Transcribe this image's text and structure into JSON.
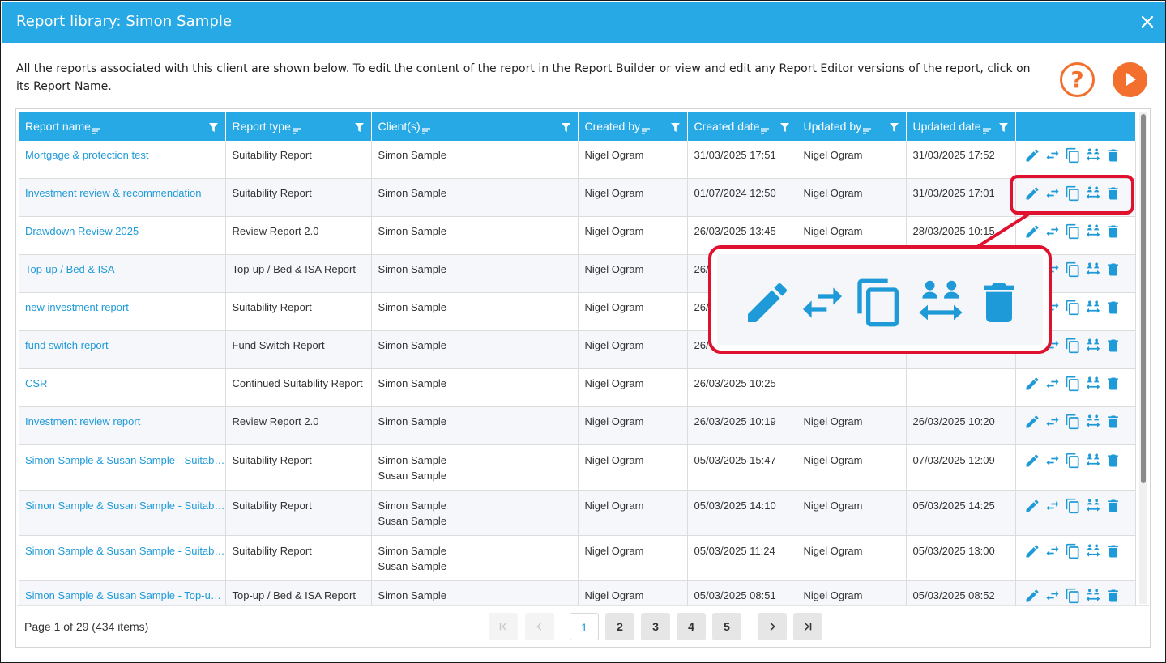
{
  "window": {
    "title": "Report library: Simon Sample",
    "close_icon": "close-icon"
  },
  "intro_text": "All the reports associated with this client are shown below. To edit the content of the report in the Report Builder or view and edit any Report Editor versions of the report, click on its Report Name.",
  "header_buttons": {
    "help_icon": "help-icon",
    "help_symbol": "?",
    "play_icon": "play-icon",
    "accent_color": "#f26f2d"
  },
  "columns": [
    "Report name",
    "Report type",
    "Client(s)",
    "Created by",
    "Created date",
    "Updated by",
    "Updated date",
    ""
  ],
  "rows": [
    {
      "name": "Mortgage & protection test",
      "type": "Suitability Report",
      "client1": "Simon Sample",
      "client2": "",
      "created_by": "Nigel Ogram",
      "created_date": "31/03/2025 17:51",
      "updated_by": "Nigel Ogram",
      "updated_date": "31/03/2025 17:52"
    },
    {
      "name": "Investment review & recommendation",
      "type": "Suitability Report",
      "client1": "Simon Sample",
      "client2": "",
      "created_by": "Nigel Ogram",
      "created_date": "01/07/2024 12:50",
      "updated_by": "Nigel Ogram",
      "updated_date": "31/03/2025 17:01"
    },
    {
      "name": "Drawdown Review 2025",
      "type": "Review Report 2.0",
      "client1": "Simon Sample",
      "client2": "",
      "created_by": "Nigel Ogram",
      "created_date": "26/03/2025 13:45",
      "updated_by": "Nigel Ogram",
      "updated_date": "28/03/2025 10:15"
    },
    {
      "name": "Top-up / Bed & ISA",
      "type": "Top-up / Bed & ISA Report",
      "client1": "Simon Sample",
      "client2": "",
      "created_by": "Nigel Ogram",
      "created_date": "26/",
      "updated_by": "",
      "updated_date": ""
    },
    {
      "name": "new investment report",
      "type": "Suitability Report",
      "client1": "Simon Sample",
      "client2": "",
      "created_by": "Nigel Ogram",
      "created_date": "26/",
      "updated_by": "",
      "updated_date": ""
    },
    {
      "name": "fund switch report",
      "type": "Fund Switch Report",
      "client1": "Simon Sample",
      "client2": "",
      "created_by": "Nigel Ogram",
      "created_date": "26/",
      "updated_by": "",
      "updated_date": ""
    },
    {
      "name": "CSR",
      "type": "Continued Suitability Report",
      "client1": "Simon Sample",
      "client2": "",
      "created_by": "Nigel Ogram",
      "created_date": "26/03/2025 10:25",
      "updated_by": "",
      "updated_date": ""
    },
    {
      "name": "Investment review report",
      "type": "Review Report 2.0",
      "client1": "Simon Sample",
      "client2": "",
      "created_by": "Nigel Ogram",
      "created_date": "26/03/2025 10:19",
      "updated_by": "Nigel Ogram",
      "updated_date": "26/03/2025 10:20"
    },
    {
      "name": "Simon Sample & Susan Sample - Suitabi…",
      "type": "Suitability Report",
      "client1": "Simon Sample",
      "client2": "Susan Sample",
      "created_by": "Nigel Ogram",
      "created_date": "05/03/2025 15:47",
      "updated_by": "Nigel Ogram",
      "updated_date": "07/03/2025 12:09"
    },
    {
      "name": "Simon Sample & Susan Sample - Suitabi…",
      "type": "Suitability Report",
      "client1": "Simon Sample",
      "client2": "Susan Sample",
      "created_by": "Nigel Ogram",
      "created_date": "05/03/2025 14:10",
      "updated_by": "Nigel Ogram",
      "updated_date": "05/03/2025 14:25"
    },
    {
      "name": "Simon Sample & Susan Sample - Suitabi…",
      "type": "Suitability Report",
      "client1": "Simon Sample",
      "client2": "Susan Sample",
      "created_by": "Nigel Ogram",
      "created_date": "05/03/2025 11:24",
      "updated_by": "Nigel Ogram",
      "updated_date": "05/03/2025 13:00"
    },
    {
      "name": "Simon Sample & Susan Sample - Top-up …",
      "type": "Top-up / Bed & ISA Report",
      "client1": "Simon Sample",
      "client2": "",
      "created_by": "Nigel Ogram",
      "created_date": "05/03/2025 08:51",
      "updated_by": "Nigel Ogram",
      "updated_date": "05/03/2025 08:52"
    }
  ],
  "row_actions": [
    "pencil-icon",
    "swap-arrows-icon",
    "copy-icon",
    "transfer-people-icon",
    "trash-icon"
  ],
  "pager": {
    "info": "Page 1 of 29 (434 items)",
    "pages": [
      "1",
      "2",
      "3",
      "4",
      "5"
    ],
    "current": "1",
    "first_icon": "first-page-icon",
    "prev_icon": "prev-page-icon",
    "next_icon": "next-page-icon",
    "last_icon": "last-page-icon"
  },
  "colors": {
    "header_blue": "#27a9e6",
    "link_blue": "#1f9ad8",
    "highlight_red": "#e0102f"
  }
}
